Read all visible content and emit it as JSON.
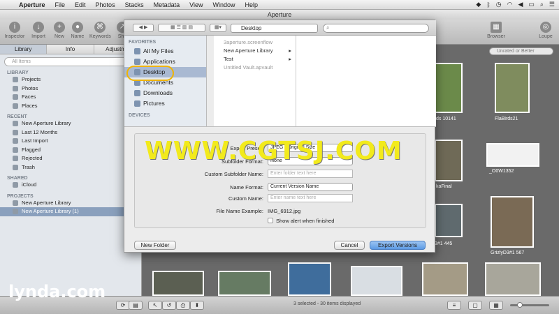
{
  "menubar": {
    "app": "Aperture",
    "items": [
      "File",
      "Edit",
      "Photos",
      "Stacks",
      "Metadata",
      "View",
      "Window",
      "Help"
    ]
  },
  "window_title": "Aperture",
  "toolbar": {
    "left": [
      {
        "label": "Inspector",
        "icon": "info-icon"
      },
      {
        "label": "Import",
        "icon": "import-icon"
      },
      {
        "label": "New",
        "icon": "plus-icon"
      },
      {
        "label": "Name",
        "icon": "user-icon"
      },
      {
        "label": "Keywords",
        "icon": "keyword-icon"
      },
      {
        "label": "Sha",
        "icon": "share-icon"
      }
    ],
    "right": [
      {
        "label": "Browser",
        "icon": "grid-icon"
      },
      {
        "label": "Loupe",
        "icon": "loupe-icon"
      }
    ]
  },
  "sidebar": {
    "tabs": [
      "Library",
      "Info",
      "Adjustme"
    ],
    "search_placeholder": "All Items",
    "sections": [
      {
        "title": "LIBRARY",
        "items": [
          "Projects",
          "Photos",
          "Faces",
          "Places"
        ]
      },
      {
        "title": "RECENT",
        "items": [
          "New Aperture Library",
          "Last 12 Months",
          "Last Import",
          "Flagged",
          "Rejected",
          "Trash"
        ]
      },
      {
        "title": "SHARED",
        "items": [
          "iCloud"
        ]
      },
      {
        "title": "PROJECTS",
        "items": [
          "New Aperture Library",
          "New Aperture Library (1)"
        ]
      }
    ]
  },
  "grid": {
    "rating_filter": "Unrated or Better",
    "captions": [
      "ds 10141",
      "FlaBirds21",
      "_O0W1352",
      "kaFinal",
      "3#1 445",
      "GrizlyD3#1 567"
    ]
  },
  "dialog": {
    "path": "Desktop",
    "favorites_heading": "FAVORITES",
    "favorites": [
      "All My Files",
      "Applications",
      "Desktop",
      "Documents",
      "Downloads",
      "Pictures"
    ],
    "devices_heading": "DEVICES",
    "files": [
      {
        "name": "3aperture.screenflow",
        "dim": true,
        "arrow": ""
      },
      {
        "name": "New Aperture Library",
        "dim": false,
        "arrow": "▸"
      },
      {
        "name": "Test",
        "dim": false,
        "arrow": "▸"
      },
      {
        "name": "Untitled Vault.apvault",
        "dim": true,
        "arrow": ""
      }
    ],
    "form": {
      "export_preset_label": "Export Preset:",
      "export_preset_value": "JPEG - Original Size",
      "subfolder_format_label": "Subfolder Format:",
      "subfolder_format_value": "None",
      "custom_subfolder_label": "Custom Subfolder Name:",
      "custom_subfolder_placeholder": "Enter folder text here",
      "name_format_label": "Name Format:",
      "name_format_value": "Current Version Name",
      "custom_name_label": "Custom Name:",
      "custom_name_placeholder": "Enter name text here",
      "example_label": "File Name Example:",
      "example_value": "IMG_6912.jpg",
      "show_alert_label": "Show alert when finished"
    },
    "buttons": {
      "new_folder": "New Folder",
      "cancel": "Cancel",
      "export": "Export Versions"
    }
  },
  "status_text": "3 selected - 30 items displayed",
  "watermark": "WWW.CGTSJ.COM",
  "brand": "lynda.com"
}
